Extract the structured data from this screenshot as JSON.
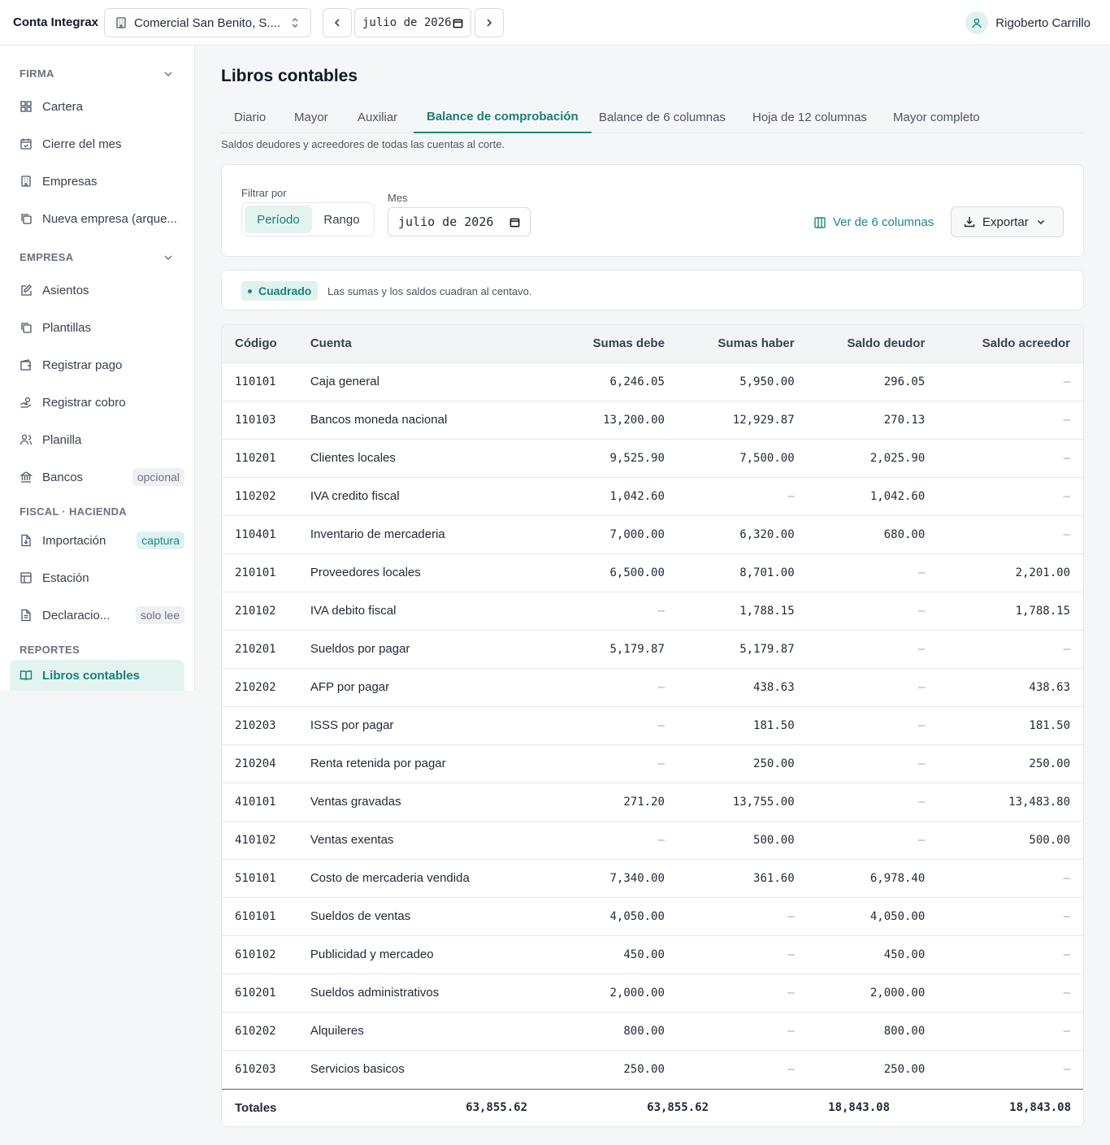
{
  "app": {
    "brand": "Conta Integrax"
  },
  "topbar": {
    "company": "Comercial San Benito, S....",
    "date_value": "julio de 2026",
    "user_name": "Rigoberto Carrillo"
  },
  "sidebar": {
    "sections": {
      "firma": "FIRMA",
      "empresa": "EMPRESA",
      "fiscal": "FISCAL · HACIENDA",
      "reportes": "REPORTES"
    },
    "items": [
      {
        "label": "Cartera",
        "icon": "grid-icon"
      },
      {
        "label": "Cierre del mes",
        "icon": "calendar-check-icon"
      },
      {
        "label": "Empresas",
        "icon": "building-icon"
      },
      {
        "label": "Nueva empresa (arque...",
        "icon": "copy-icon"
      },
      {
        "label": "Asientos",
        "icon": "edit-icon"
      },
      {
        "label": "Plantillas",
        "icon": "copy-icon"
      },
      {
        "label": "Registrar pago",
        "icon": "wallet-icon"
      },
      {
        "label": "Registrar cobro",
        "icon": "hand-coins-icon"
      },
      {
        "label": "Planilla",
        "icon": "users-icon"
      },
      {
        "label": "Bancos",
        "icon": "bank-icon",
        "badge": "opcional"
      },
      {
        "label": "Importación",
        "icon": "file-import-icon",
        "badge": "captura"
      },
      {
        "label": "Estación",
        "icon": "table-icon"
      },
      {
        "label": "Declaracio...",
        "icon": "file-text-icon",
        "badge": "solo lee"
      },
      {
        "label": "Libros contables",
        "icon": "book-open-icon"
      }
    ]
  },
  "main": {
    "title": "Libros contables",
    "tabs": [
      "Diario",
      "Mayor",
      "Auxiliar",
      "Balance de comprobación",
      "Balance de 6 columnas",
      "Hoja de 12 columnas",
      "Mayor completo"
    ],
    "subtitle": "Saldos deudores y acreedores de todas las cuentas al corte."
  },
  "filters": {
    "filter_label": "Filtrar por",
    "option_period": "Período",
    "option_range": "Rango",
    "month_label": "Mes",
    "month_value": "julio de 2026",
    "view6_label": "Ver de 6 columnas",
    "export_label": "Exportar"
  },
  "status": {
    "badge": "Cuadrado",
    "message": "Las sumas y los saldos cuadran al centavo."
  },
  "table": {
    "headers": [
      "Código",
      "Cuenta",
      "Sumas debe",
      "Sumas haber",
      "Saldo deudor",
      "Saldo acreedor"
    ],
    "rows": [
      [
        "110101",
        "Caja general",
        "6,246.05",
        "5,950.00",
        "296.05",
        "—"
      ],
      [
        "110103",
        "Bancos moneda nacional",
        "13,200.00",
        "12,929.87",
        "270.13",
        "—"
      ],
      [
        "110201",
        "Clientes locales",
        "9,525.90",
        "7,500.00",
        "2,025.90",
        "—"
      ],
      [
        "110202",
        "IVA credito fiscal",
        "1,042.60",
        "—",
        "1,042.60",
        "—"
      ],
      [
        "110401",
        "Inventario de mercaderia",
        "7,000.00",
        "6,320.00",
        "680.00",
        "—"
      ],
      [
        "210101",
        "Proveedores locales",
        "6,500.00",
        "8,701.00",
        "—",
        "2,201.00"
      ],
      [
        "210102",
        "IVA debito fiscal",
        "—",
        "1,788.15",
        "—",
        "1,788.15"
      ],
      [
        "210201",
        "Sueldos por pagar",
        "5,179.87",
        "5,179.87",
        "—",
        "—"
      ],
      [
        "210202",
        "AFP por pagar",
        "—",
        "438.63",
        "—",
        "438.63"
      ],
      [
        "210203",
        "ISSS por pagar",
        "—",
        "181.50",
        "—",
        "181.50"
      ],
      [
        "210204",
        "Renta retenida por pagar",
        "—",
        "250.00",
        "—",
        "250.00"
      ],
      [
        "410101",
        "Ventas gravadas",
        "271.20",
        "13,755.00",
        "—",
        "13,483.80"
      ],
      [
        "410102",
        "Ventas exentas",
        "—",
        "500.00",
        "—",
        "500.00"
      ],
      [
        "510101",
        "Costo de mercaderia vendida",
        "7,340.00",
        "361.60",
        "6,978.40",
        "—"
      ],
      [
        "610101",
        "Sueldos de ventas",
        "4,050.00",
        "—",
        "4,050.00",
        "—"
      ],
      [
        "610102",
        "Publicidad y mercadeo",
        "450.00",
        "—",
        "450.00",
        "—"
      ],
      [
        "610201",
        "Sueldos administrativos",
        "2,000.00",
        "—",
        "2,000.00",
        "—"
      ],
      [
        "610202",
        "Alquileres",
        "800.00",
        "—",
        "800.00",
        "—"
      ],
      [
        "610203",
        "Servicios basicos",
        "250.00",
        "—",
        "250.00",
        "—"
      ]
    ],
    "totals": {
      "label": "Totales",
      "values": [
        "63,855.62",
        "63,855.62",
        "18,843.08",
        "18,843.08"
      ]
    }
  }
}
